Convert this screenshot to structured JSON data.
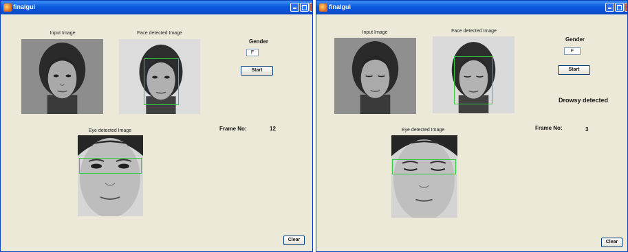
{
  "windows": [
    {
      "title": "finalgui",
      "input_label": "Input Image",
      "face_label": "Face detected Image",
      "eye_label": "Eye detected Image",
      "gender_label": "Gender",
      "gender_value": "F",
      "start_label": "Start",
      "status_text": "",
      "frame_label": "Frame No:",
      "frame_value": "12",
      "clear_label": "Clear",
      "eyes_state": "open"
    },
    {
      "title": "finalgui",
      "input_label": "Input Image",
      "face_label": "Face detected Image",
      "eye_label": "Eye detected Image",
      "gender_label": "Gender",
      "gender_value": "F",
      "start_label": "Start",
      "status_text": "Drowsy detected",
      "frame_label": "Frame No:",
      "frame_value": "3",
      "clear_label": "Clear",
      "eyes_state": "closed"
    }
  ],
  "colors": {
    "window_bg": "#ece9d8",
    "titlebar": "#0b5ae0",
    "detection_box": "#2ecc40"
  }
}
